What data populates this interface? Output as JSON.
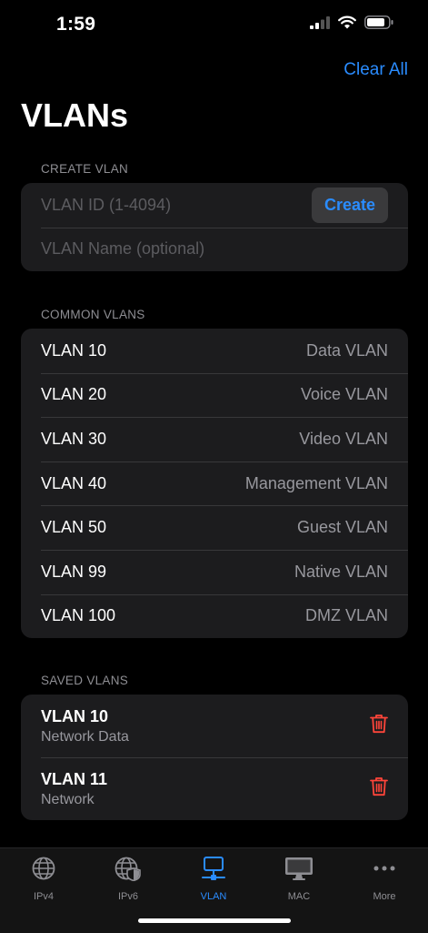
{
  "status": {
    "time": "1:59"
  },
  "header": {
    "clear_all": "Clear All",
    "title": "VLANs"
  },
  "create": {
    "section_title": "CREATE VLAN",
    "id_placeholder": "VLAN ID (1-4094)",
    "name_placeholder": "VLAN Name (optional)",
    "create_label": "Create"
  },
  "common": {
    "section_title": "COMMON VLANS",
    "items": [
      {
        "vlan": "VLAN 10",
        "name": "Data VLAN"
      },
      {
        "vlan": "VLAN 20",
        "name": "Voice VLAN"
      },
      {
        "vlan": "VLAN 30",
        "name": "Video VLAN"
      },
      {
        "vlan": "VLAN 40",
        "name": "Management VLAN"
      },
      {
        "vlan": "VLAN 50",
        "name": "Guest VLAN"
      },
      {
        "vlan": "VLAN 99",
        "name": "Native VLAN"
      },
      {
        "vlan": "VLAN 100",
        "name": "DMZ VLAN"
      }
    ]
  },
  "saved": {
    "section_title": "SAVED VLANS",
    "items": [
      {
        "vlan": "VLAN 10",
        "name": "Network Data"
      },
      {
        "vlan": "VLAN 11",
        "name": "Network"
      }
    ]
  },
  "tabs": [
    {
      "label": "IPv4",
      "icon": "globe-icon"
    },
    {
      "label": "IPv6",
      "icon": "globe-shield-icon"
    },
    {
      "label": "VLAN",
      "icon": "network-monitor-icon",
      "active": true
    },
    {
      "label": "MAC",
      "icon": "desktop-icon"
    },
    {
      "label": "More",
      "icon": "ellipsis-icon"
    }
  ],
  "colors": {
    "accent": "#2a8cff",
    "delete": "#ff453a",
    "card": "#1c1c1e"
  }
}
